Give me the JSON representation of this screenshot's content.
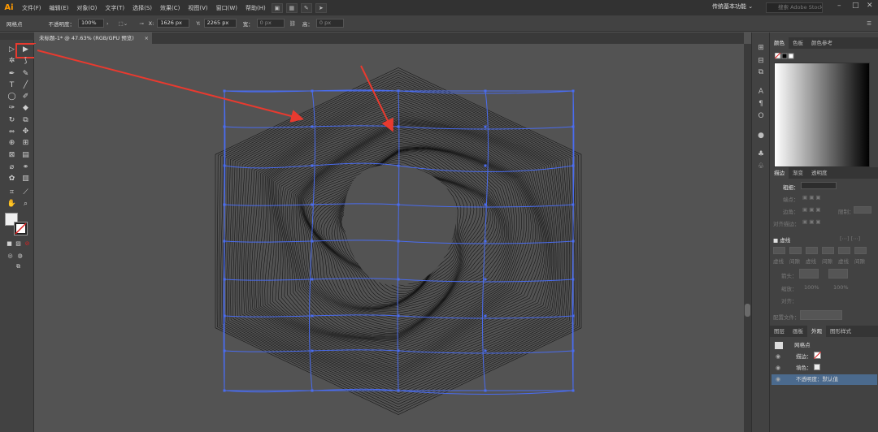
{
  "app": {
    "logo": "Ai",
    "menu": [
      "文件(F)",
      "编辑(E)",
      "对象(O)",
      "文字(T)",
      "选择(S)",
      "效果(C)",
      "视图(V)",
      "窗口(W)",
      "帮助(H)"
    ],
    "workspace": "传统基本功能",
    "stock_search_placeholder": "搜索 Adobe Stock"
  },
  "control_bar": {
    "selection": "网格点",
    "opacity_label": "不透明度：",
    "opacity_value": "100%",
    "x_label": "X:",
    "x_value": "1626 px",
    "y_label": "Y:",
    "y_value": "2265 px",
    "w_label": "宽：",
    "w_value": "0 px",
    "h_label": "高：",
    "h_value": "0 px"
  },
  "document": {
    "tab_title": "未标题-1* @ 47.63% (RGB/GPU 预览)",
    "close": "×"
  },
  "panels": {
    "color_tabs": [
      "颜色",
      "色板",
      "颜色参考"
    ],
    "stroke_tabs": [
      "描边",
      "渐变",
      "透明度"
    ],
    "stroke": {
      "weight_label": "粗细：",
      "cap_label": "端点：",
      "corner_label": "边角：",
      "limit_label": "限制：",
      "align_label": "对齐描边：",
      "dashed_label": "虚线",
      "dash_labels": [
        "虚线",
        "间隙",
        "虚线",
        "间隙",
        "虚线",
        "间隙"
      ],
      "arrow_label": "箭头：",
      "scale_label": "缩放：",
      "scale_values": [
        "100%",
        "100%"
      ],
      "align2_label": "对齐：",
      "profile_label": "配置文件："
    },
    "appearance_tabs": [
      "图层",
      "画板",
      "外观",
      "图形样式"
    ],
    "appearance": {
      "title": "网格点",
      "stroke_label": "描边：",
      "fill_label": "填色：",
      "opacity_label": "不透明度：默认值"
    }
  },
  "colors": {
    "accent": "#ff9a00",
    "highlight": "#e83a2f",
    "mesh": "#4a6cf0",
    "selected_row": "#4b6a8d"
  }
}
